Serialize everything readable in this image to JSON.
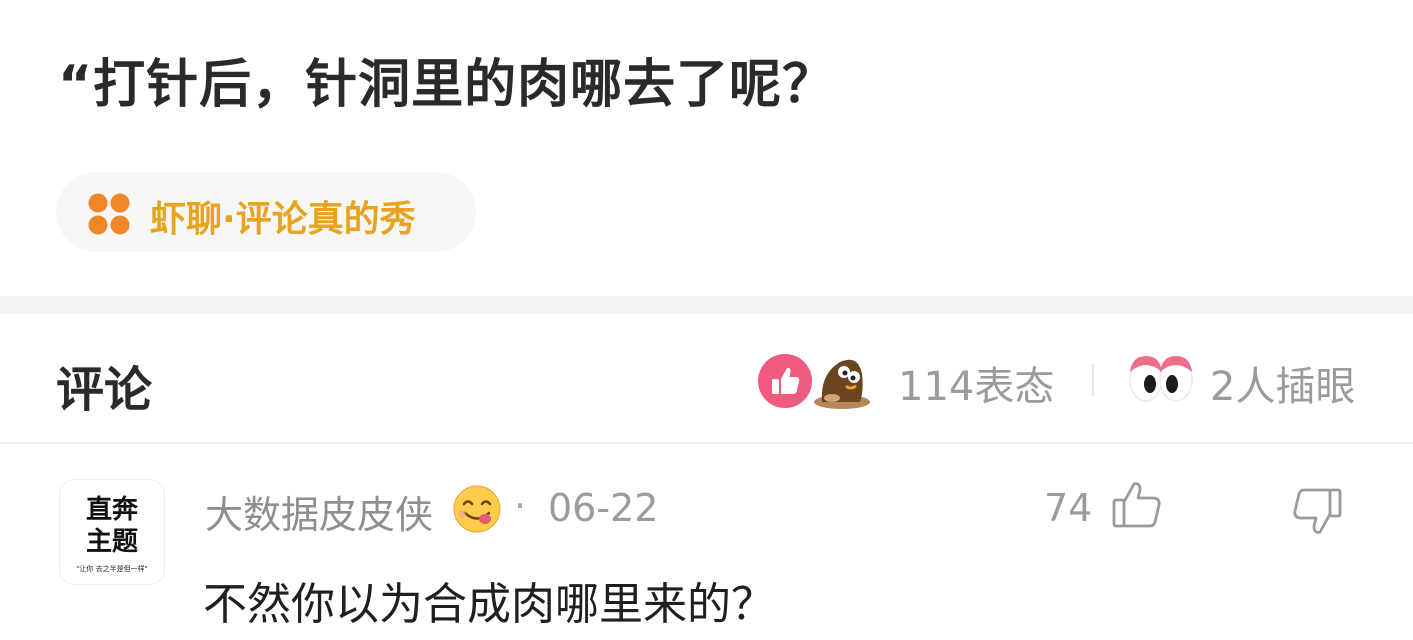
{
  "post": {
    "title": "“打针后，针洞里的肉哪去了呢？",
    "topic_label": "虾聊·评论真的秀",
    "topic_icon": "four-petal-icon",
    "topic_color": "#e8a31f"
  },
  "comments_header": {
    "title": "评论",
    "reactions_label": "114表态",
    "pokes_label": "2人插眼",
    "reaction_icons": [
      "thumbs-up-reaction-icon",
      "mole-reaction-icon"
    ],
    "poke_icon": "eyes-icon",
    "like_reaction_color": "#f05a7e"
  },
  "comments": [
    {
      "avatar_lines": [
        "直奔",
        "主题"
      ],
      "avatar_tagline": "\"让你 去之半是但一样\"",
      "username": "大数据皮皮侠",
      "username_emoji": "yum-face-emoji",
      "separator": "·",
      "date": "06-22",
      "like_count": "74",
      "text": "不然你以为合成肉哪里来的？"
    }
  ]
}
